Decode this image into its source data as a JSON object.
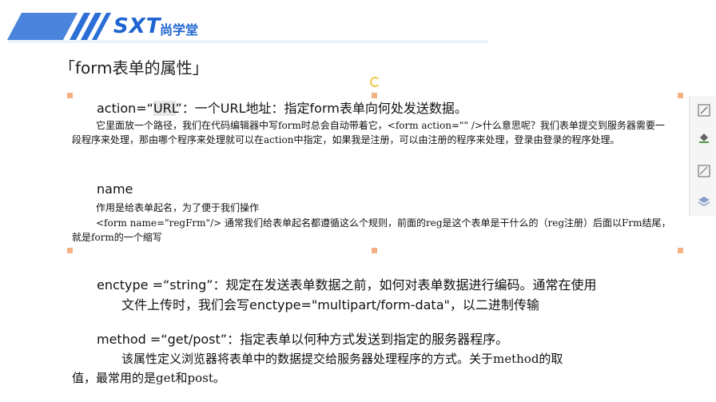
{
  "logo": {
    "text": "SXT",
    "cn": "尚学堂"
  },
  "title": "「form表单的属性」",
  "action": {
    "prefix": "action=“",
    "url": "URL",
    "suffix": "”：一个URL地址：指定form表单向何处发送数据。",
    "desc": "它里面放一个路径，我们在代码编辑器中写form时总会自动带着它，<form action=\"\" />什么意思呢？我们表单提交到服务器需要一段程序来处理，那由哪个程序来处理就可以在action中指定，如果我是注册，可以由注册的程序来处理，登录由登录的程序处理。"
  },
  "name": {
    "heading": "name",
    "line1": "作用是给表单起名，为了便于我们操作",
    "line2": "<form name=\"regFrm\"/>  通常我们给表单起名都遵循这么个规则，前面的reg是这个表单是干什么的（reg注册）后面以Frm结尾，就是form的一个缩写"
  },
  "enctype": {
    "line1": "enctype =“string”：规定在发送表单数据之前，如何对表单数据进行编码。通常在使用",
    "line2": "文件上传时，我们会写enctype=\"multipart/form-data\"，以二进制传输"
  },
  "method": {
    "line1": "method =“get/post”：指定表单以何种方式发送到指定的服务器程序。",
    "line2": "该属性定义浏览器将表单中的数据提交给服务器处理程序的方式。关于method的取",
    "line3": "值，最常用的是get和post。"
  },
  "tools": [
    "edit-icon",
    "fill-icon",
    "image-icon",
    "layers-icon"
  ]
}
